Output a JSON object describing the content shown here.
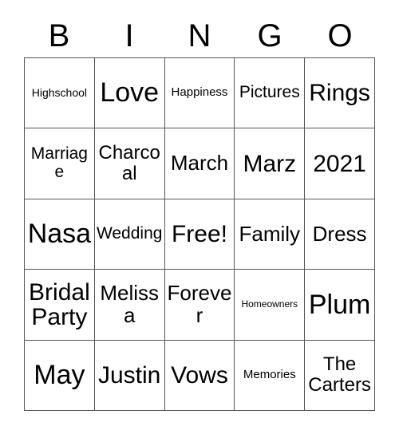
{
  "card": {
    "title": "BINGO",
    "background_color": "#ffffff",
    "text_color": "#000000",
    "border_color": "#555555"
  },
  "header": {
    "letters": [
      "B",
      "I",
      "N",
      "G",
      "O"
    ]
  },
  "grid": {
    "columns": 5,
    "rows": 5,
    "free_space": "Free!",
    "cells": [
      {
        "text": "Highschool",
        "size": "fs-s"
      },
      {
        "text": "Love",
        "size": "fs-xxl"
      },
      {
        "text": "Happiness",
        "size": "fs-sm"
      },
      {
        "text": "Pictures",
        "size": "fs-m"
      },
      {
        "text": "Rings",
        "size": "fs-xl"
      },
      {
        "text": "Marriage",
        "size": "fs-m"
      },
      {
        "text": "Charcoal",
        "size": "fs-ml"
      },
      {
        "text": "March",
        "size": "fs-l"
      },
      {
        "text": "Marz",
        "size": "fs-xl"
      },
      {
        "text": "2021",
        "size": "fs-xl"
      },
      {
        "text": "Nasa",
        "size": "fs-xxl"
      },
      {
        "text": "Wedding",
        "size": "fs-m"
      },
      {
        "text": "Free!",
        "size": "fs-xl"
      },
      {
        "text": "Family",
        "size": "fs-l"
      },
      {
        "text": "Dress",
        "size": "fs-l"
      },
      {
        "text": "Bridal Party",
        "size": "fs-xl"
      },
      {
        "text": "Melissa",
        "size": "fs-l"
      },
      {
        "text": "Forever",
        "size": "fs-l"
      },
      {
        "text": "Homeowners",
        "size": "fs-xs"
      },
      {
        "text": "Plum",
        "size": "fs-xxl"
      },
      {
        "text": "May",
        "size": "fs-xxl"
      },
      {
        "text": "Justin",
        "size": "fs-xl"
      },
      {
        "text": "Vows",
        "size": "fs-xl"
      },
      {
        "text": "Memories",
        "size": "fs-sm"
      },
      {
        "text": "The Carters",
        "size": "fs-ml"
      }
    ]
  }
}
